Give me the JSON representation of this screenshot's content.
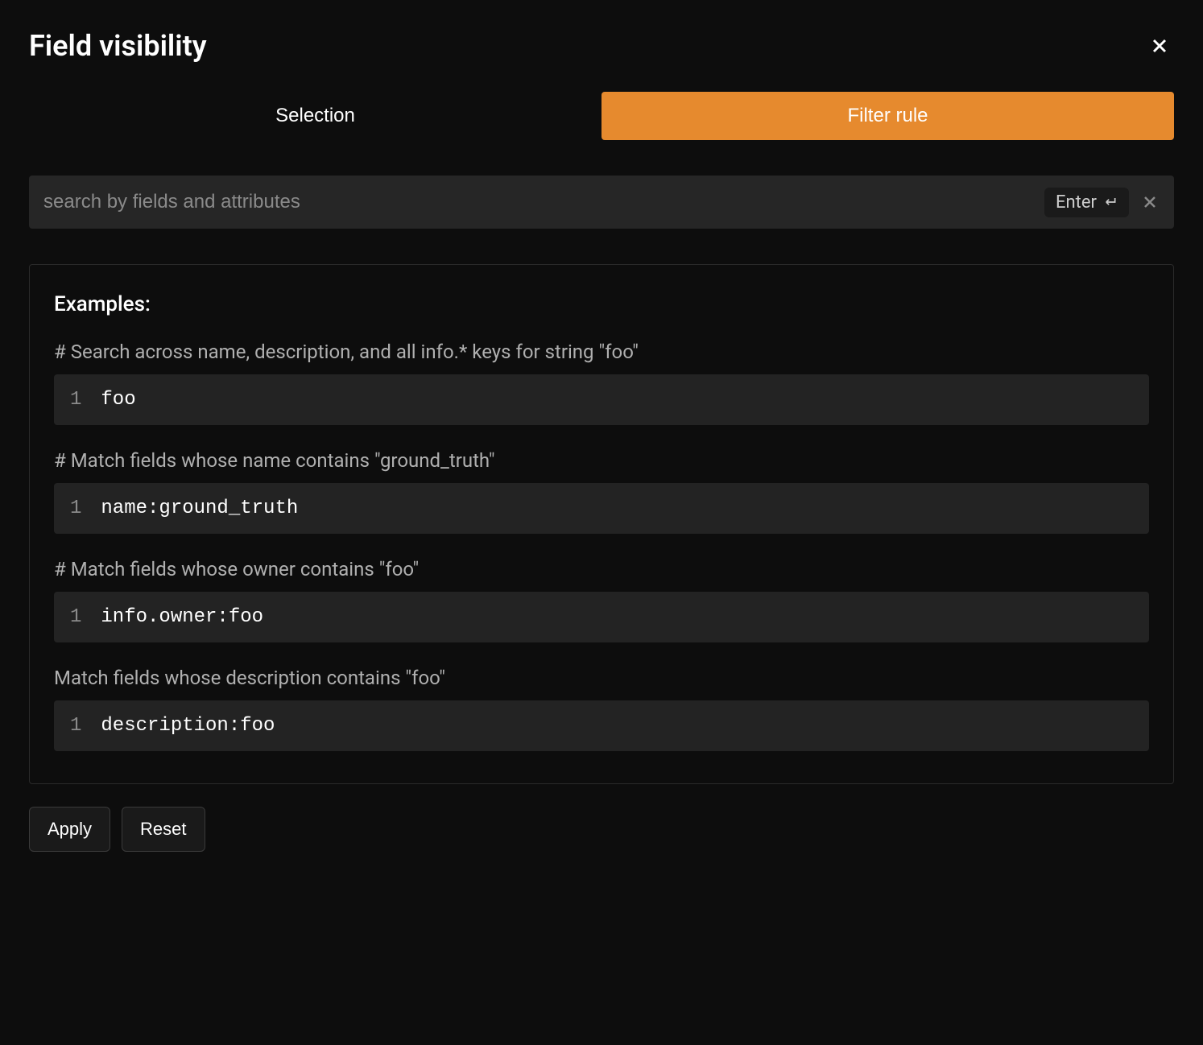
{
  "header": {
    "title": "Field visibility"
  },
  "tabs": {
    "selection": "Selection",
    "filter_rule": "Filter rule"
  },
  "search": {
    "placeholder": "search by fields and attributes",
    "enter_label": "Enter"
  },
  "examples": {
    "heading": "Examples:",
    "items": [
      {
        "desc": "# Search across name, description, and all info.* keys for string \"foo\"",
        "line": "1",
        "code": "foo"
      },
      {
        "desc": "# Match fields whose name contains \"ground_truth\"",
        "line": "1",
        "code": "name:ground_truth"
      },
      {
        "desc": "# Match fields whose owner contains \"foo\"",
        "line": "1",
        "code": "info.owner:foo"
      },
      {
        "desc": "Match fields whose description contains \"foo\"",
        "line": "1",
        "code": "description:foo"
      }
    ]
  },
  "actions": {
    "apply": "Apply",
    "reset": "Reset"
  }
}
